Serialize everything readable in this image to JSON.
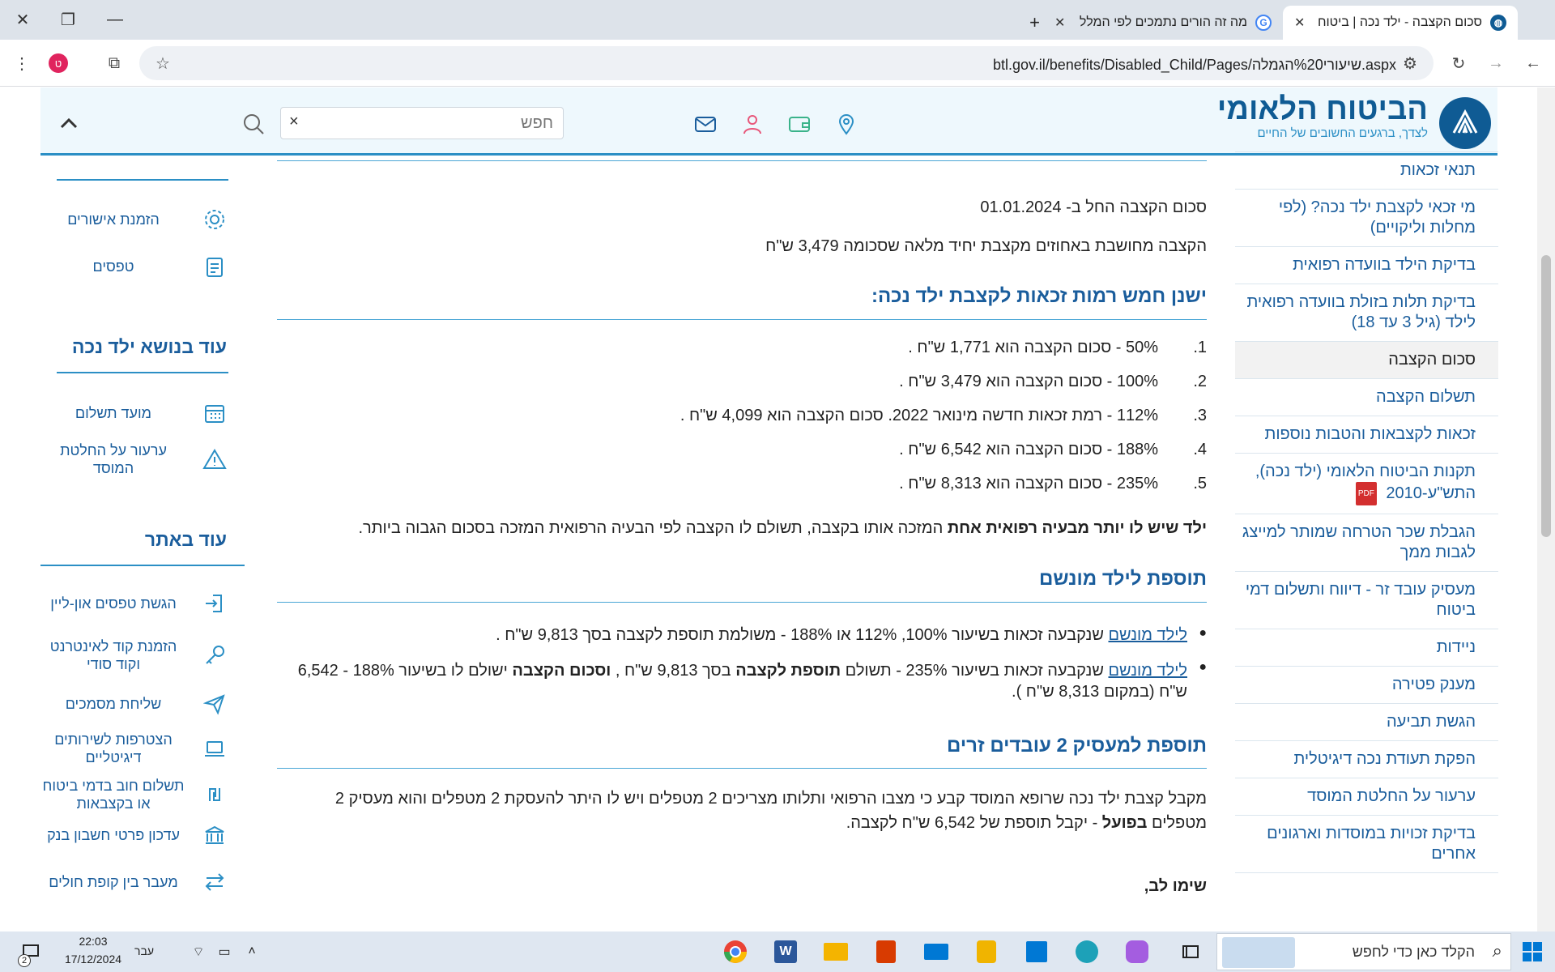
{
  "browser": {
    "tabs": [
      {
        "title": "סכום הקצבה - ילד נכה | ביטוח ל",
        "active": true
      },
      {
        "title": "מה זה הורים נתמכים לפי המלל",
        "active": false
      }
    ],
    "url": "btl.gov.il/benefits/Disabled_Child/Pages/שיעורי%20הגמלה.aspx",
    "profile_initial": "ט"
  },
  "site": {
    "brand_name": "הביטוח הלאומי",
    "tagline": "לצדך, ברגעים החשובים של החיים",
    "search_placeholder": "חפש",
    "search_clear": "×"
  },
  "right_nav": [
    {
      "label": "תנאי זכאות"
    },
    {
      "label": "מי זכאי לקצבת ילד נכה? (לפי מחלות וליקויים)"
    },
    {
      "label": "בדיקת הילד בוועדה רפואית"
    },
    {
      "label": "בדיקת תלות בזולת בוועדה רפואית לילד (גיל 3 עד 18)"
    },
    {
      "label": "סכום הקצבה",
      "active": true
    },
    {
      "label": "תשלום הקצבה"
    },
    {
      "label": "זכאות לקצבאות והטבות נוספות"
    },
    {
      "label": "תקנות הביטוח הלאומי (ילד נכה), התש\"ע-2010",
      "pdf": true
    },
    {
      "label": "הגבלת שכר הטרחה שמותר למייצג לגבות ממך"
    },
    {
      "label": "מעסיק עובד זר - דיווח ותשלום דמי ביטוח"
    },
    {
      "label": "ניידות"
    },
    {
      "label": "מענק פטירה"
    },
    {
      "label": "הגשת תביעה"
    },
    {
      "label": "הפקת תעודת נכה דיגיטלית"
    },
    {
      "label": "ערעור על החלטת המוסד"
    },
    {
      "label": "בדיקת זכויות במוסדות וארגונים אחרים"
    }
  ],
  "main": {
    "intro_date": "סכום הקצבה החל ב- 01.01.2024",
    "intro_base": "הקצבה מחושבת באחוזים מקצבת יחיד מלאה שסכומה 3,479 ש\"ח",
    "levels_heading": "ישנן חמש רמות זכאות לקצבת ילד נכה:",
    "levels": [
      {
        "num": "1.",
        "text": "50% - סכום הקצבה הוא 1,771 ש\"ח ."
      },
      {
        "num": "2.",
        "text": "100% - סכום הקצבה הוא 3,479 ש\"ח ."
      },
      {
        "num": "3.",
        "text": "112% - רמת זכאות חדשה מינואר 2022. סכום הקצבה הוא 4,099 ש\"ח ."
      },
      {
        "num": "4.",
        "text": "188% - סכום הקצבה הוא 6,542 ש\"ח ."
      },
      {
        "num": "5.",
        "text": "235% - סכום הקצבה הוא 8,313 ש\"ח ."
      }
    ],
    "multi_bold": "ילד שיש לו יותר מבעיה רפואית אחת",
    "multi_rest": " המזכה אותו בקצבה, תשולם לו הקצבה לפי הבעיה הרפואית המזכה בסכום הגבוה ביותר.",
    "addon_heading": "תוספת לילד מונשם",
    "addon_link": "לילד מונשם",
    "addon_b1_rest": " שנקבעה זכאות בשיעור 100%, 112% או 188% - משולמת תוספת לקצבה בסך 9,813 ש\"ח .",
    "addon_b2_a": " שנקבעה זכאות בשיעור 235% - תשולם ",
    "addon_b2_bold1": "תוספת לקצבה",
    "addon_b2_b": " בסך 9,813 ש\"ח , ",
    "addon_b2_bold2": "וסכום הקצבה",
    "addon_b2_c": " ישולם לו בשיעור 188% - 6,542 ש\"ח (במקום  8,313 ש\"ח ).",
    "employer_heading": "תוספת למעסיק 2 עובדים זרים",
    "employer_a": "מקבל קצבת ילד נכה שרופא המוסד קבע כי מצבו הרפואי ותלותו מצריכים 2 מטפלים  ויש לו היתר להעסקת 2 מטפלים והוא מעסיק 2 מטפלים ",
    "employer_bold": "בפועל",
    "employer_b": " - יקבל תוספת של 6,542 ש\"ח  לקצבה.",
    "note_heading": "שימו לב,"
  },
  "left_sidebar": {
    "top_items": [
      {
        "label": "הזמנת אישורים",
        "icon": "gear-icon"
      },
      {
        "label": "טפסים",
        "icon": "clipboard-icon"
      }
    ],
    "topic_heading": "עוד בנושא ילד נכה",
    "topic_items": [
      {
        "label": "מועד תשלום",
        "icon": "calendar-icon"
      },
      {
        "label": "ערעור על החלטת המוסד",
        "icon": "warning-icon"
      }
    ],
    "site_heading": "עוד באתר",
    "site_items": [
      {
        "label": "הגשת טפסים און-ליין",
        "icon": "login-icon"
      },
      {
        "label": "הזמנת קוד לאינטרנט וקוד סודי",
        "icon": "key-icon"
      },
      {
        "label": "שליחת מסמכים",
        "icon": "send-icon"
      },
      {
        "label": "הצטרפות לשירותים דיגיטליים",
        "icon": "laptop-icon"
      },
      {
        "label": "תשלום חוב בדמי ביטוח או בקצבאות",
        "icon": "shekel-icon"
      },
      {
        "label": "עדכון פרטי חשבון בנק",
        "icon": "bank-icon"
      },
      {
        "label": "מעבר בין קופת חולים",
        "icon": "transfer-icon"
      }
    ]
  },
  "taskbar": {
    "search_placeholder": "הקלד כאן כדי לחפש",
    "time": "22:03",
    "date": "17/12/2024",
    "language": "עבר",
    "notif_count": "2"
  },
  "colors": {
    "brand": "#0f5b94",
    "link": "#1a5d9c",
    "accent": "#2b8fc5"
  }
}
